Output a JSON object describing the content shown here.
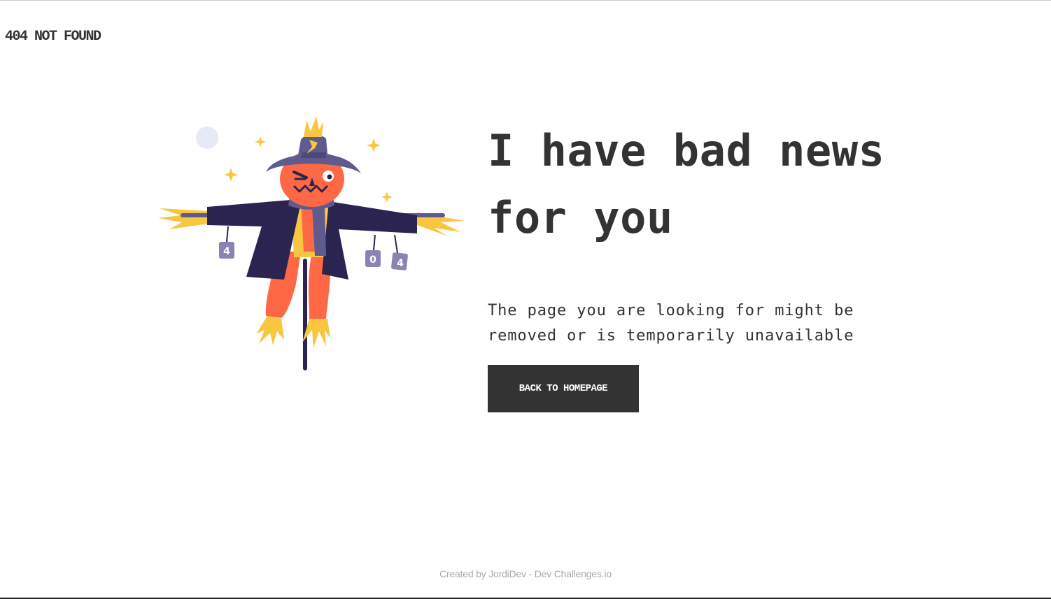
{
  "header": {
    "brand": "404 NOT FOUND"
  },
  "illustration": {
    "icon": "scarecrow-illustration",
    "can_labels": [
      "4",
      "0",
      "4"
    ]
  },
  "main": {
    "headline": "I have bad news for you",
    "description": "The page you are looking for might be removed or is temporarily unavailable",
    "cta_label": "BACK TO HOMEPAGE"
  },
  "footer": {
    "credit": "Created by JordiDev - Dev Challenges.io"
  },
  "colors": {
    "text": "#333333",
    "button_bg": "#333333",
    "button_text": "#ffffff",
    "footer_text": "#a9a9a9",
    "hat": "#5f5b8f",
    "coat": "#2b2450",
    "face": "#ff6845",
    "straw": "#f8c73f"
  }
}
